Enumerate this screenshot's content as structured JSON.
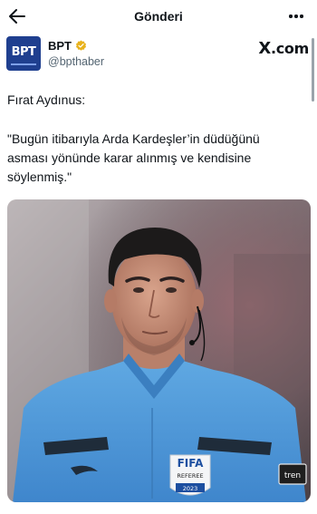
{
  "header": {
    "title": "Gönderi",
    "back_icon": "arrow-left-icon",
    "more_icon": "more-horizontal-icon"
  },
  "author": {
    "avatar_text": "BPT",
    "name": "BPT",
    "handle": "@bpthaber",
    "verified": true,
    "verified_color": "#e8b21c",
    "brand_logo": "X",
    "brand_suffix": ".com"
  },
  "post": {
    "line1": "Fırat Aydınus:",
    "quote": "\"Bugün itibarıyla Arda Kardeşler’in düdüğünü asması yönünde karar alınmış ve kendisine söylenmiş.\""
  },
  "media": {
    "badge_top": "FIFA",
    "badge_mid": "REFEREE",
    "badge_year": "2023",
    "sleeve_text": "tren"
  }
}
